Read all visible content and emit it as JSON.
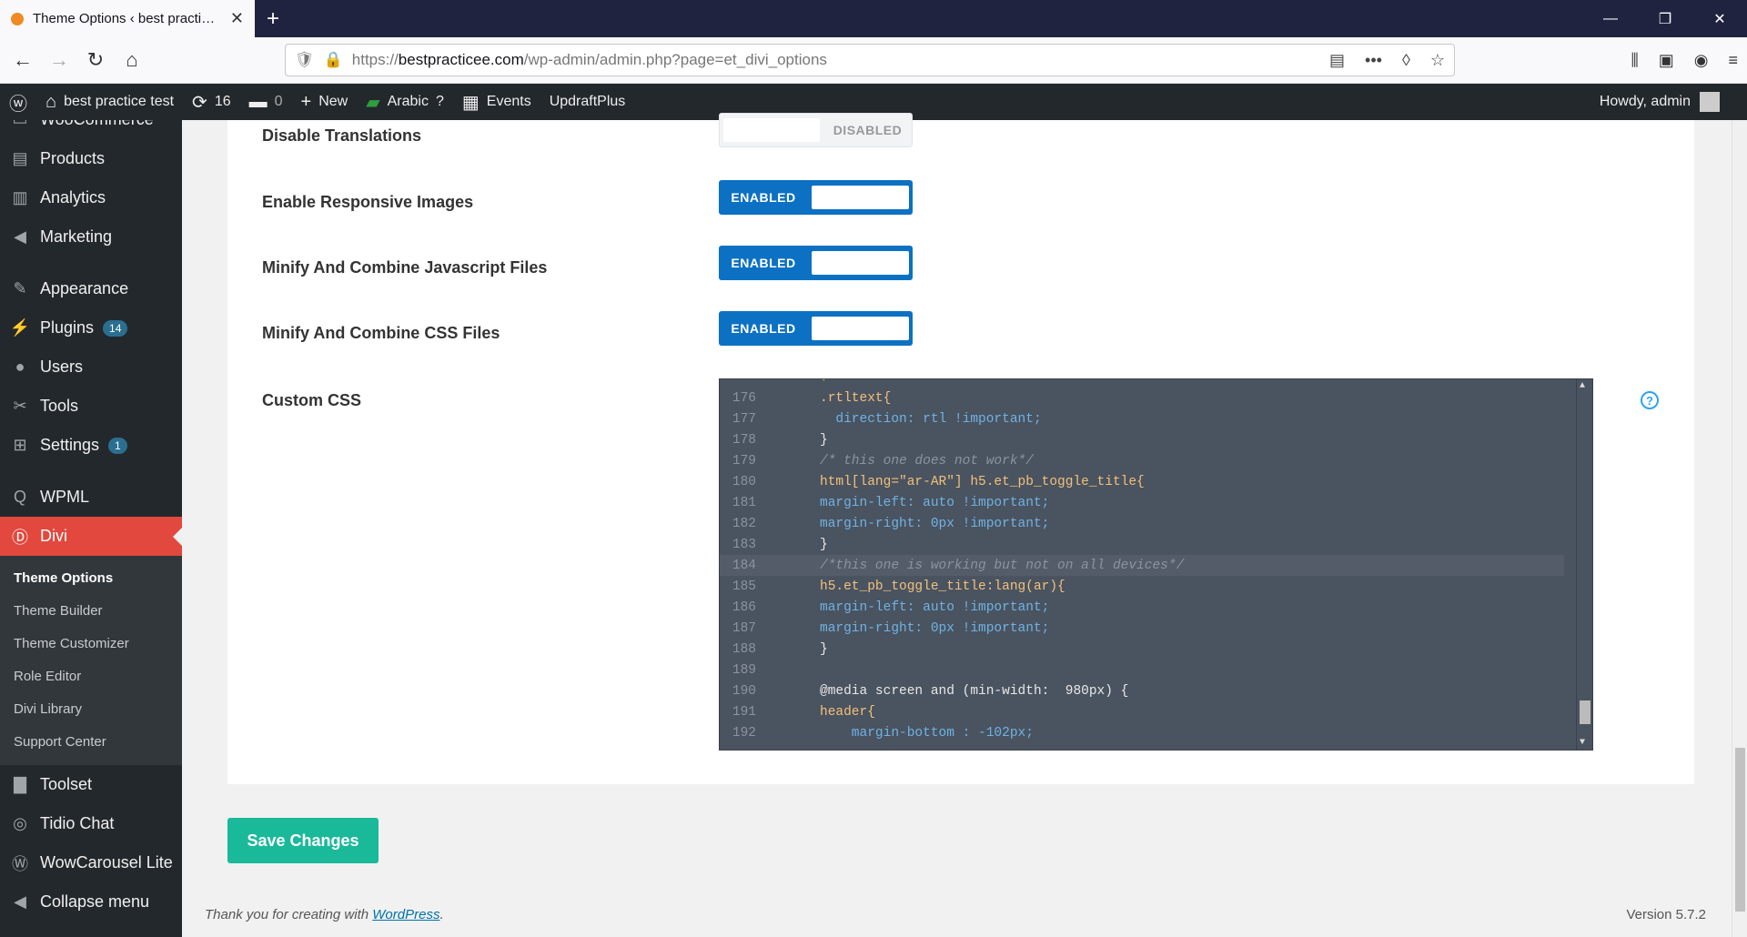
{
  "browser": {
    "tab_title": "Theme Options ‹ best practice test",
    "url_prefix": "https://",
    "url_host": "bestpracticee.com",
    "url_path": "/wp-admin/admin.php?page=et_divi_options"
  },
  "adminbar": {
    "site_name": "best practice test",
    "updates_count": "16",
    "comments_count": "0",
    "new_label": "New",
    "language_label": "Arabic",
    "events_label": "Events",
    "updraft_label": "UpdraftPlus",
    "howdy": "Howdy, admin"
  },
  "sidebar": {
    "items": [
      {
        "label": "WooCommerce",
        "icon": "woo-icon"
      },
      {
        "label": "Products",
        "icon": "box-icon"
      },
      {
        "label": "Analytics",
        "icon": "chart-icon"
      },
      {
        "label": "Marketing",
        "icon": "megaphone-icon"
      },
      {
        "label": "Appearance",
        "icon": "brush-icon"
      },
      {
        "label": "Plugins",
        "icon": "plugin-icon",
        "badge": "14"
      },
      {
        "label": "Users",
        "icon": "user-icon"
      },
      {
        "label": "Tools",
        "icon": "wrench-icon"
      },
      {
        "label": "Settings",
        "icon": "settings-icon",
        "badge": "1"
      },
      {
        "label": "WPML",
        "icon": "wpml-icon"
      },
      {
        "label": "Divi",
        "icon": "divi-icon"
      }
    ],
    "divi_sub": [
      "Theme Options",
      "Theme Builder",
      "Theme Customizer",
      "Role Editor",
      "Divi Library",
      "Support Center"
    ],
    "bottom_items": [
      {
        "label": "Toolset",
        "icon": "toolset-icon"
      },
      {
        "label": "Tidio Chat",
        "icon": "chat-icon"
      },
      {
        "label": "WowCarousel Lite",
        "icon": "carousel-icon"
      },
      {
        "label": "Collapse menu",
        "icon": "collapse-icon"
      }
    ]
  },
  "options": [
    {
      "label": "Disable Translations",
      "state": "DISABLED"
    },
    {
      "label": "Enable Responsive Images",
      "state": "ENABLED"
    },
    {
      "label": "Minify And Combine Javascript Files",
      "state": "ENABLED"
    },
    {
      "label": "Minify And Combine CSS Files",
      "state": "ENABLED"
    }
  ],
  "custom_css_label": "Custom CSS",
  "save_label": "Save Changes",
  "footer": {
    "text": "Thank you for creating with ",
    "link": "WordPress",
    "end": "."
  },
  "version": "Version 5.7.2",
  "code_lines": [
    {
      "n": "176",
      "t": ".rtltext{"
    },
    {
      "n": "177",
      "t": "  direction: rtl !important;"
    },
    {
      "n": "178",
      "t": "}"
    },
    {
      "n": "179",
      "t": "/* this one does not work*/"
    },
    {
      "n": "180",
      "t": "html[lang=\"ar-AR\"] h5.et_pb_toggle_title{"
    },
    {
      "n": "181",
      "t": "margin-left: auto !important;"
    },
    {
      "n": "182",
      "t": "margin-right: 0px !important;"
    },
    {
      "n": "183",
      "t": "}"
    },
    {
      "n": "184",
      "t": "/*this one is working but not on all devices*/"
    },
    {
      "n": "185",
      "t": "h5.et_pb_toggle_title:lang(ar){"
    },
    {
      "n": "186",
      "t": "margin-left: auto !important;"
    },
    {
      "n": "187",
      "t": "margin-right: 0px !important;"
    },
    {
      "n": "188",
      "t": "}"
    },
    {
      "n": "189",
      "t": ""
    },
    {
      "n": "190",
      "t": "@media screen and (min-width:  980px) {"
    },
    {
      "n": "191",
      "t": "header{"
    },
    {
      "n": "192",
      "t": "    margin-bottom : -102px;"
    }
  ]
}
